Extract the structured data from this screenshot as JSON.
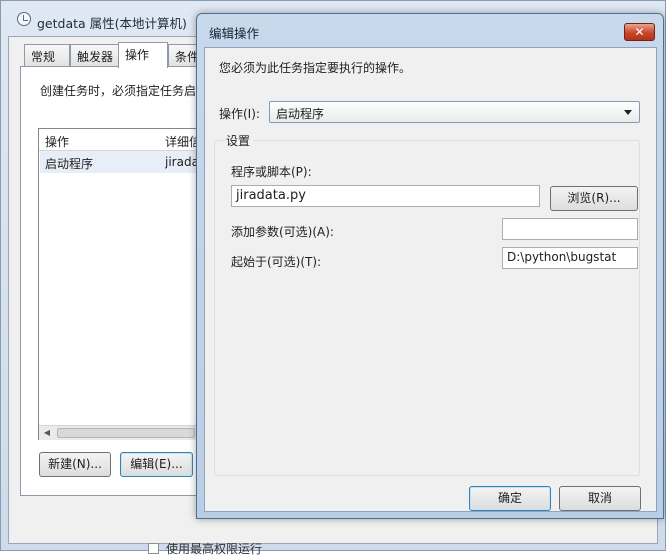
{
  "background_window": {
    "title": "getdata 属性(本地计算机)",
    "tabs": [
      "常规",
      "触发器",
      "操作",
      "条件"
    ],
    "active_tab": "操作",
    "description": "创建任务时，必须指定任务启",
    "list": {
      "columns": [
        "操作",
        "详细信"
      ],
      "rows": [
        {
          "action": "启动程序",
          "detail": "jirada"
        }
      ]
    },
    "new_button": "新建(N)...",
    "edit_button": "编辑(E)...",
    "checkbox_label": "使用最高权限运行"
  },
  "dialog": {
    "title": "编辑操作",
    "close_label": "✕",
    "instruction": "您必须为此任务指定要执行的操作。",
    "action_label": "操作(I):",
    "action_value": "启动程序",
    "settings_label": "设置",
    "program_label": "程序或脚本(P):",
    "program_value": "jiradata.py",
    "browse_button": "浏览(R)...",
    "args_label": "添加参数(可选)(A):",
    "args_value": "",
    "start_label": "起始于(可选)(T):",
    "start_value": "D:\\python\\bugstat",
    "ok_button": "确定",
    "cancel_button": "取消"
  }
}
